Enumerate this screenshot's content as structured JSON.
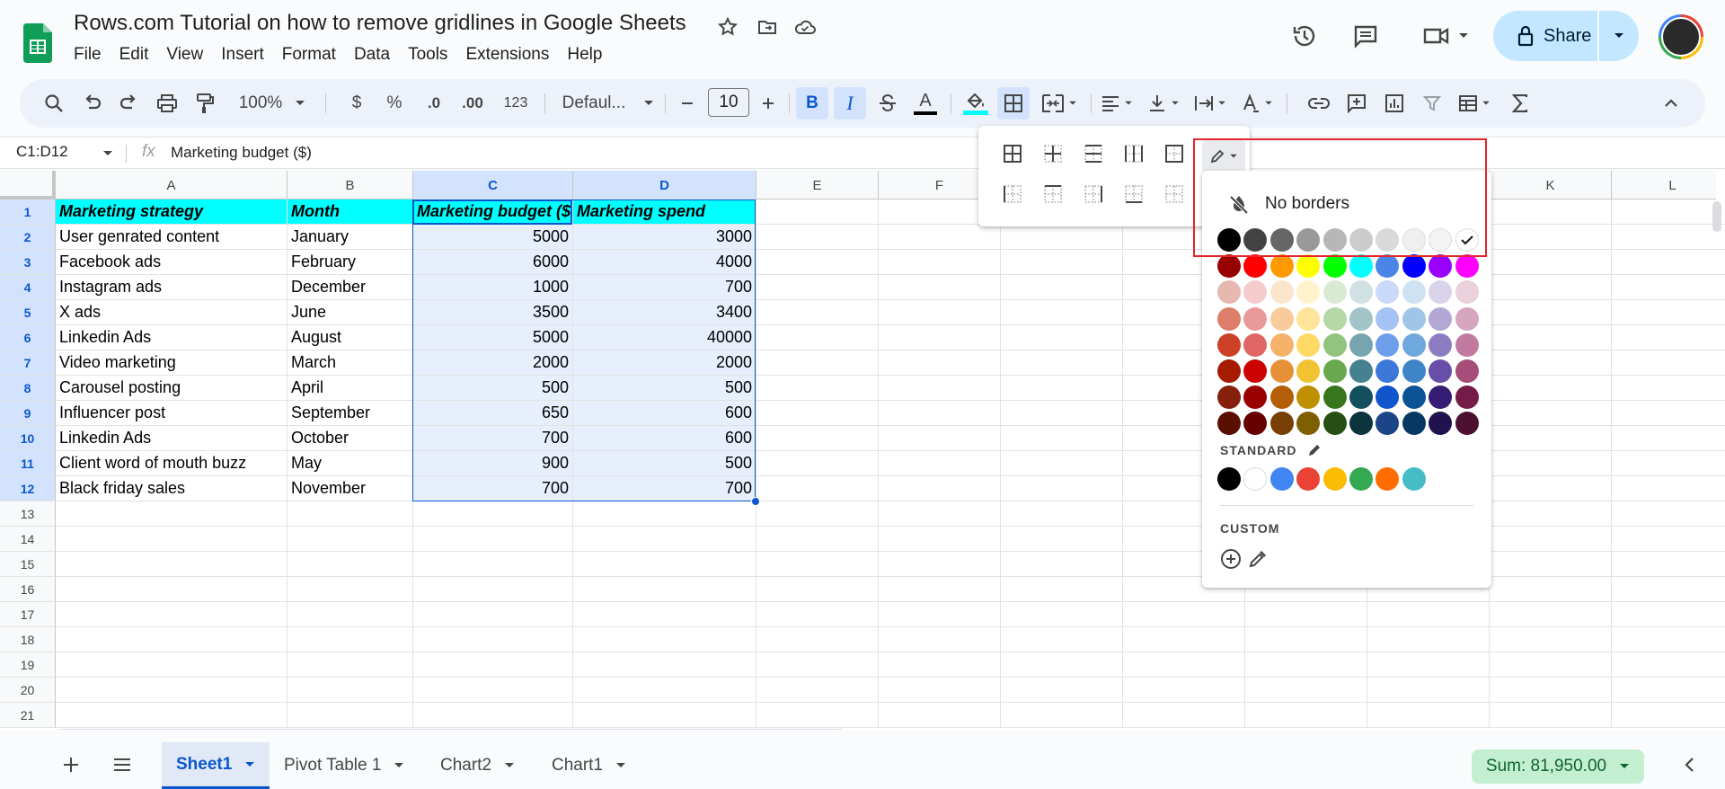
{
  "header": {
    "title": "Rows.com Tutorial on how to remove gridlines in Google Sheets",
    "menu": [
      "File",
      "Edit",
      "View",
      "Insert",
      "Format",
      "Data",
      "Tools",
      "Extensions",
      "Help"
    ],
    "share_label": "Share"
  },
  "toolbar": {
    "zoom": "100%",
    "currency": "$",
    "percent": "%",
    "dec_decrease": ".0",
    "dec_increase": ".00",
    "number_format": "123",
    "font": "Defaul...",
    "font_size": "10",
    "bold": "B",
    "italic": "I",
    "text_color_letter": "A",
    "fill_color": "#00ffff"
  },
  "formula_bar": {
    "name_box": "C1:D12",
    "fx": "fx",
    "content": "Marketing budget ($)"
  },
  "grid": {
    "columns": [
      "A",
      "B",
      "C",
      "D",
      "E",
      "F",
      "G",
      "H",
      "I",
      "J",
      "K",
      "L"
    ],
    "selected_columns": [
      "C",
      "D"
    ],
    "rows": [
      "1",
      "2",
      "3",
      "4",
      "5",
      "6",
      "7",
      "8",
      "9",
      "10",
      "11",
      "12",
      "13",
      "14",
      "15",
      "16",
      "17",
      "18",
      "19",
      "20",
      "21"
    ],
    "headers": [
      "Marketing strategy",
      "Month",
      "Marketing budget ($",
      "Marketing spend"
    ],
    "data": [
      [
        "User genrated content",
        "January",
        "5000",
        "3000"
      ],
      [
        "Facebook ads",
        "February",
        "6000",
        "4000"
      ],
      [
        "Instagram ads",
        "December",
        "1000",
        "700"
      ],
      [
        "X ads",
        "June",
        "3500",
        "3400"
      ],
      [
        "Linkedin Ads",
        "August",
        "5000",
        "40000"
      ],
      [
        "Video marketing",
        "March",
        "2000",
        "2000"
      ],
      [
        "Carousel posting",
        "April",
        "500",
        "500"
      ],
      [
        "Influencer post",
        "September",
        "650",
        "600"
      ],
      [
        "Linkedin Ads",
        "October",
        "700",
        "600"
      ],
      [
        "Client word of mouth buzz",
        "May",
        "900",
        "500"
      ],
      [
        "Black friday sales",
        "November",
        "700",
        "700"
      ]
    ],
    "header_fill": "#00ffff",
    "selection_fill": "#e7effd"
  },
  "border_panel": {
    "no_borders_label": "No borders",
    "standard_label": "STANDARD",
    "custom_label": "CUSTOM",
    "selected_color": "#ffffff",
    "grays": [
      "#000000",
      "#434343",
      "#666666",
      "#999999",
      "#b7b7b7",
      "#cccccc",
      "#d9d9d9",
      "#efefef",
      "#f3f3f3",
      "#ffffff"
    ],
    "palette": [
      [
        "#980000",
        "#ff0000",
        "#ff9900",
        "#ffff00",
        "#00ff00",
        "#00ffff",
        "#4a86e8",
        "#0000ff",
        "#9900ff",
        "#ff00ff"
      ],
      [
        "#e6b8af",
        "#f4cccc",
        "#fce5cd",
        "#fff2cc",
        "#d9ead3",
        "#d0e0e3",
        "#c9daf8",
        "#cfe2f3",
        "#d9d2e9",
        "#ead1dc"
      ],
      [
        "#dd7e6b",
        "#ea9999",
        "#f9cb9c",
        "#ffe599",
        "#b6d7a8",
        "#a2c4c9",
        "#a4c2f4",
        "#9fc5e8",
        "#b4a7d6",
        "#d5a6bd"
      ],
      [
        "#cc4125",
        "#e06666",
        "#f6b26b",
        "#ffd966",
        "#93c47d",
        "#76a5af",
        "#6d9eeb",
        "#6fa8dc",
        "#8e7cc3",
        "#c27ba0"
      ],
      [
        "#a61c00",
        "#cc0000",
        "#e69138",
        "#f1c232",
        "#6aa84f",
        "#45818e",
        "#3c78d8",
        "#3d85c6",
        "#674ea7",
        "#a64d79"
      ],
      [
        "#85200c",
        "#990000",
        "#b45f06",
        "#bf9000",
        "#38761d",
        "#134f5c",
        "#1155cc",
        "#0b5394",
        "#351c75",
        "#741b47"
      ],
      [
        "#5b0f00",
        "#660000",
        "#783f04",
        "#7f6000",
        "#274e13",
        "#0c343d",
        "#1c4587",
        "#073763",
        "#20124d",
        "#4c1130"
      ]
    ],
    "standard": [
      "#000000",
      "#ffffff",
      "#4285f4",
      "#ea4335",
      "#fbbc04",
      "#34a853",
      "#ff6d01",
      "#46bdc6"
    ]
  },
  "bottom": {
    "sheets": [
      "Sheet1",
      "Pivot Table 1",
      "Chart2",
      "Chart1"
    ],
    "active_sheet": "Sheet1",
    "sum_label": "Sum: 81,950.00"
  },
  "annotation": {
    "highlight_color": "#e3242b"
  }
}
